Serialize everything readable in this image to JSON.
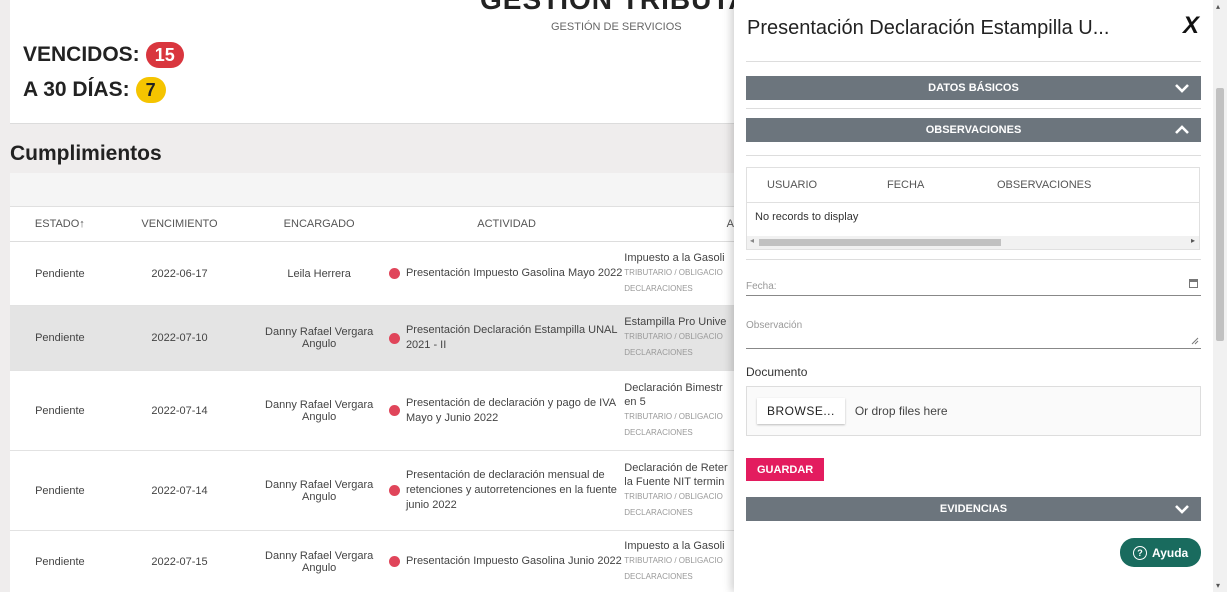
{
  "header": {
    "title": "GESTIÓN TRIBUTARIA",
    "subtitle": "GESTIÓN DE SERVICIOS"
  },
  "stats": {
    "overdue_label": "VENCIDOS:",
    "overdue_count": "15",
    "overdue_color": "#d9363e",
    "due30_label": "A 30 DÍAS:",
    "due30_count": "7",
    "due30_color": "#f5c400"
  },
  "compliance": {
    "section_title": "Cumplimientos",
    "columns": {
      "estado": "ESTADO↑",
      "vencimiento": "VENCIMIENTO",
      "encargado": "ENCARGADO",
      "actividad": "ACTIVIDAD",
      "col5": "A"
    },
    "rows": [
      {
        "estado": "Pendiente",
        "vencimiento": "2022-06-17",
        "encargado": "Leila Herrera",
        "actividad": "Presentación Impuesto Gasolina Mayo 2022",
        "detalle": "Impuesto a la Gasoli",
        "categoria": "TRIBUTARIO / OBLIGACIO",
        "tipo": "DECLARACIONES"
      },
      {
        "estado": "Pendiente",
        "vencimiento": "2022-07-10",
        "encargado": "Danny Rafael Vergara Angulo",
        "actividad": "Presentación Declaración Estampilla UNAL 2021 - II",
        "detalle": "Estampilla Pro Unive",
        "categoria": "TRIBUTARIO / OBLIGACIO",
        "tipo": "DECLARACIONES"
      },
      {
        "estado": "Pendiente",
        "vencimiento": "2022-07-14",
        "encargado": "Danny Rafael Vergara Angulo",
        "actividad": "Presentación de declaración y pago de IVA Mayo y Junio 2022",
        "detalle": "Declaración Bimestr",
        "detalle2": "en 5",
        "categoria": "TRIBUTARIO / OBLIGACIO",
        "tipo": "DECLARACIONES"
      },
      {
        "estado": "Pendiente",
        "vencimiento": "2022-07-14",
        "encargado": "Danny Rafael Vergara Angulo",
        "actividad": "Presentación de declaración mensual de retenciones y autorretenciones en la fuente junio 2022",
        "detalle": "Declaración de Reter",
        "detalle2": "la Fuente NIT termin",
        "categoria": "TRIBUTARIO / OBLIGACIO",
        "tipo": "DECLARACIONES"
      },
      {
        "estado": "Pendiente",
        "vencimiento": "2022-07-15",
        "encargado": "Danny Rafael Vergara Angulo",
        "actividad": "Presentación Impuesto Gasolina Junio 2022",
        "detalle": "Impuesto a la Gasoli",
        "categoria": "TRIBUTARIO / OBLIGACIO",
        "tipo": "DECLARACIONES"
      }
    ]
  },
  "panel": {
    "title": "Presentación Declaración Estampilla U...",
    "close_label": "X",
    "sections": {
      "datos_basicos": "DATOS BÁSICOS",
      "observaciones": "OBSERVACIONES",
      "evidencias": "EVIDENCIAS"
    },
    "grid": {
      "col_usuario": "USUARIO",
      "col_fecha": "FECHA",
      "col_observaciones": "OBSERVACIONES",
      "empty": "No records to display"
    },
    "form": {
      "fecha_label": "Fecha:",
      "observacion_label": "Observación",
      "documento_label": "Documento",
      "browse_label": "BROWSE...",
      "drop_text": "Or drop files here",
      "save_label": "GUARDAR"
    },
    "accent_color": "#e31c5f",
    "section_color": "#6c757d"
  },
  "help": {
    "label": "Ayuda",
    "icon": "question-circle-icon",
    "color": "#196b5e"
  }
}
